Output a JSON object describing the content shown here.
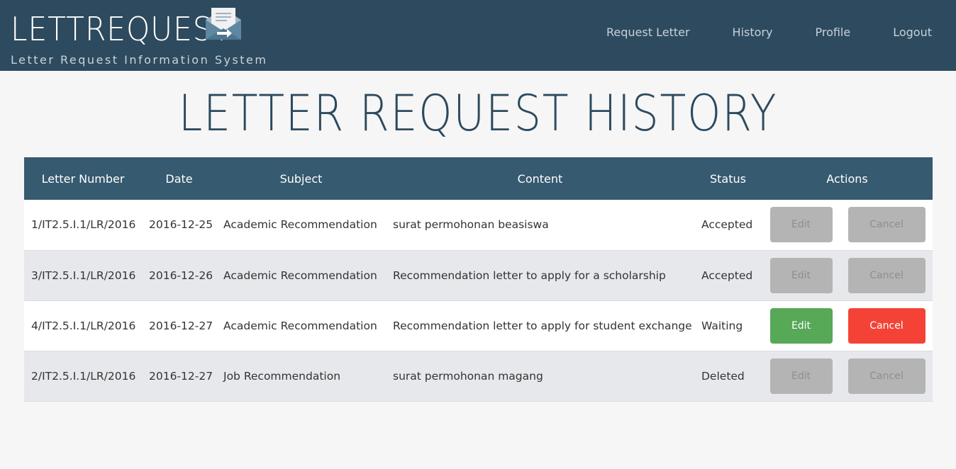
{
  "app": {
    "title": "LETTREQUEST",
    "subtitle": "Letter Request Information System",
    "logo_icon": "envelope-icon"
  },
  "nav": {
    "items": [
      {
        "label": "Request Letter"
      },
      {
        "label": "History"
      },
      {
        "label": "Profile"
      },
      {
        "label": "Logout"
      }
    ]
  },
  "page": {
    "title": "LETTER REQUEST HISTORY"
  },
  "table": {
    "headers": [
      "Letter Number",
      "Date",
      "Subject",
      "Content",
      "Status",
      "Actions"
    ],
    "rows": [
      {
        "number": "1/IT2.5.I.1/LR/2016",
        "date": "2016-12-25",
        "subject": "Academic Recommendation",
        "content": "surat permohonan beasiswa",
        "status": "Accepted",
        "edit": "Edit",
        "cancel": "Cancel",
        "enabled": false
      },
      {
        "number": "3/IT2.5.I.1/LR/2016",
        "date": "2016-12-26",
        "subject": "Academic Recommendation",
        "content": "Recommendation letter to apply for a scholarship",
        "status": "Accepted",
        "edit": "Edit",
        "cancel": "Cancel",
        "enabled": false
      },
      {
        "number": "4/IT2.5.I.1/LR/2016",
        "date": "2016-12-27",
        "subject": "Academic Recommendation",
        "content": "Recommendation letter to apply for student exchange",
        "status": "Waiting",
        "edit": "Edit",
        "cancel": "Cancel",
        "enabled": true
      },
      {
        "number": "2/IT2.5.I.1/LR/2016",
        "date": "2016-12-27",
        "subject": "Job Recommendation",
        "content": "surat permohonan magang",
        "status": "Deleted",
        "edit": "Edit",
        "cancel": "Cancel",
        "enabled": false
      }
    ]
  },
  "colors": {
    "navbar": "#2d4a5e",
    "table_header": "#365a6f",
    "edit_active": "#57a857",
    "cancel_active": "#f44336",
    "disabled": "#b4b4b4"
  }
}
